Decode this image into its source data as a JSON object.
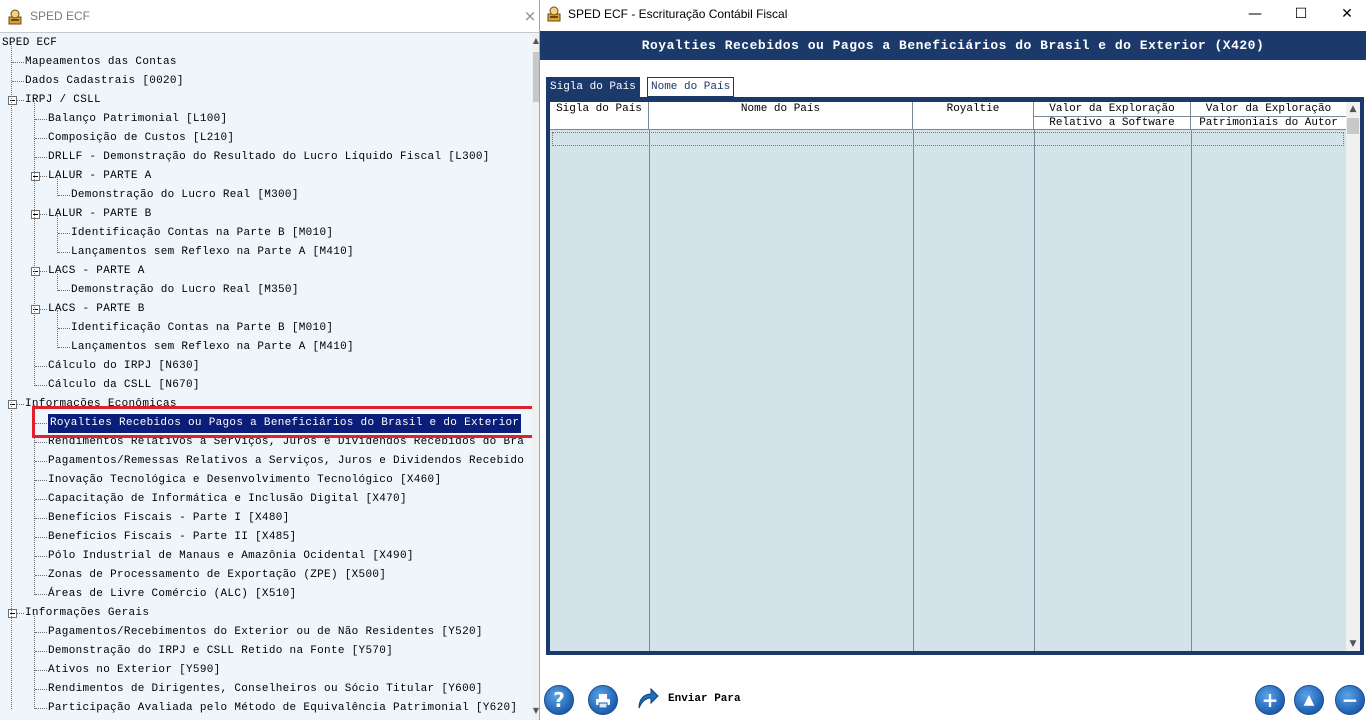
{
  "left_window": {
    "title": "SPED ECF",
    "close_glyph": "×",
    "tree": [
      {
        "label": "SPED ECF",
        "level": 0,
        "expander": false
      },
      {
        "label": "Mapeamentos das Contas",
        "level": 1,
        "expander": false
      },
      {
        "label": "Dados Cadastrais [0020]",
        "level": 1,
        "expander": false
      },
      {
        "label": "IRPJ / CSLL",
        "level": 1,
        "expander": true
      },
      {
        "label": "Balanço Patrimonial [L100]",
        "level": 2,
        "expander": false
      },
      {
        "label": "Composição de Custos [L210]",
        "level": 2,
        "expander": false
      },
      {
        "label": "DRLLF - Demonstração do Resultado do Lucro Líquido Fiscal [L300]",
        "level": 2,
        "expander": false
      },
      {
        "label": "LALUR - PARTE A",
        "level": 2,
        "expander": true
      },
      {
        "label": "Demonstração do Lucro Real [M300]",
        "level": 3,
        "expander": false
      },
      {
        "label": "LALUR - PARTE B",
        "level": 2,
        "expander": true
      },
      {
        "label": "Identificação Contas na Parte B [M010]",
        "level": 3,
        "expander": false
      },
      {
        "label": "Lançamentos sem Reflexo na Parte A [M410]",
        "level": 3,
        "expander": false
      },
      {
        "label": "LACS - PARTE A",
        "level": 2,
        "expander": true
      },
      {
        "label": "Demonstração do Lucro Real [M350]",
        "level": 3,
        "expander": false
      },
      {
        "label": "LACS - PARTE B",
        "level": 2,
        "expander": true
      },
      {
        "label": "Identificação Contas na Parte B [M010]",
        "level": 3,
        "expander": false
      },
      {
        "label": "Lançamentos sem Reflexo na Parte A [M410]",
        "level": 3,
        "expander": false
      },
      {
        "label": "Cálculo do IRPJ [N630]",
        "level": 2,
        "expander": false
      },
      {
        "label": "Cálculo da CSLL [N670]",
        "level": 2,
        "expander": false
      },
      {
        "label": "Informações Econômicas",
        "level": 1,
        "expander": true
      },
      {
        "label": "Royalties Recebidos ou Pagos a Beneficiários do Brasil e do Exterior",
        "level": 2,
        "expander": false,
        "selected": true
      },
      {
        "label": "Rendimentos Relativos a Serviços, Juros e Dividendos Recebidos do Bra",
        "level": 2,
        "expander": false
      },
      {
        "label": "Pagamentos/Remessas Relativos a Serviços, Juros e Dividendos Recebido",
        "level": 2,
        "expander": false
      },
      {
        "label": "Inovação Tecnológica e Desenvolvimento Tecnológico [X460]",
        "level": 2,
        "expander": false
      },
      {
        "label": "Capacitação de Informática e Inclusão Digital [X470]",
        "level": 2,
        "expander": false
      },
      {
        "label": "Benefícios Fiscais - Parte I [X480]",
        "level": 2,
        "expander": false
      },
      {
        "label": "Benefícios Fiscais - Parte II [X485]",
        "level": 2,
        "expander": false
      },
      {
        "label": "Pólo Industrial de Manaus e Amazônia Ocidental [X490]",
        "level": 2,
        "expander": false
      },
      {
        "label": "Zonas de Processamento de Exportação (ZPE) [X500]",
        "level": 2,
        "expander": false
      },
      {
        "label": "Áreas de Livre Comércio (ALC) [X510]",
        "level": 2,
        "expander": false
      },
      {
        "label": "Informações Gerais",
        "level": 1,
        "expander": true
      },
      {
        "label": "Pagamentos/Recebimentos do Exterior ou de Não Residentes [Y520]",
        "level": 2,
        "expander": false
      },
      {
        "label": "Demonstração do IRPJ e CSLL Retido na Fonte [Y570]",
        "level": 2,
        "expander": false
      },
      {
        "label": "Ativos no Exterior [Y590]",
        "level": 2,
        "expander": false
      },
      {
        "label": "Rendimentos de Dirigentes, Conselheiros ou Sócio Titular [Y600]",
        "level": 2,
        "expander": false
      },
      {
        "label": "Participação Avaliada pelo Método de Equivalência Patrimonial [Y620]",
        "level": 2,
        "expander": false
      }
    ]
  },
  "right_window": {
    "title": "SPED ECF  -  Escrituração Contábil Fiscal",
    "minimize_glyph": "—",
    "maximize_glyph": "☐",
    "close_glyph": "✕",
    "form_title": "Royalties Recebidos ou Pagos a Beneficiários do Brasil e do Exterior (X420)",
    "tabs": [
      {
        "label": "Sigla do País",
        "active": true
      },
      {
        "label": "Nome do País",
        "active": false
      }
    ],
    "grid": {
      "columns": [
        {
          "line1": "Sigla do País",
          "line2": ""
        },
        {
          "line1": "Nome do País",
          "line2": ""
        },
        {
          "line1": "Royaltie",
          "line2": ""
        },
        {
          "line1": "Valor da Exploração",
          "line2": "Relativo a Software"
        },
        {
          "line1": "Valor da Exploração",
          "line2": "Patrimoniais do Autor"
        }
      ],
      "rows": []
    },
    "toolbar": {
      "help_glyph": "?",
      "print_glyph": "⎙",
      "send_label": "Enviar Para",
      "add_glyph": "+",
      "up_glyph": "▲",
      "remove_glyph": "−"
    }
  },
  "colors": {
    "header_bg": "#1b3a6b",
    "selection_bg": "#0a1d78",
    "highlight_border": "#e0202c",
    "grid_bg": "#d4e2ea",
    "tree_bg": "#eef6fb"
  }
}
